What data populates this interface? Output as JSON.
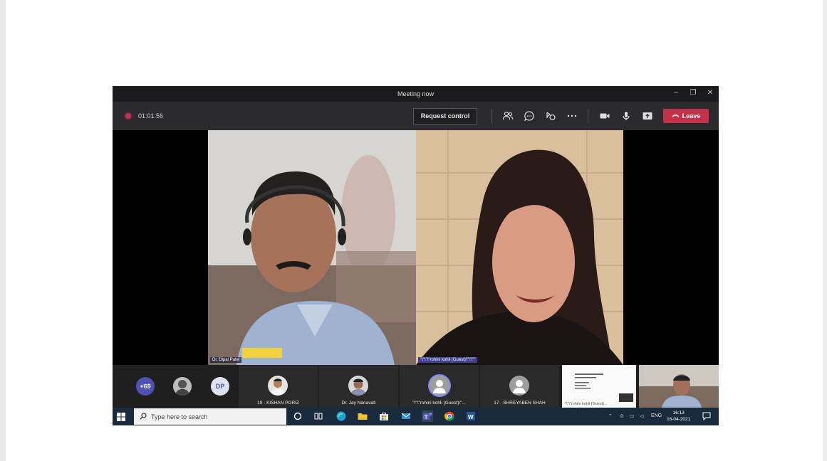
{
  "window": {
    "title": "Meeting now",
    "minimize_glyph": "–",
    "restore_glyph": "❐",
    "close_glyph": "✕"
  },
  "toolbar": {
    "timer": "01:01:56",
    "request_control_label": "Request control",
    "leave_label": "Leave",
    "icons": [
      "participants-icon",
      "chat-icon",
      "reactions-icon",
      "more-options-icon",
      "camera-icon",
      "microphone-icon",
      "share-screen-icon"
    ],
    "leave_color": "#c4314b"
  },
  "videos": [
    {
      "name": "Dr. Dipal Patel"
    },
    {
      "name": "\"\\\"\\\"\\\"rohini kohli (Guest)\\\"\\\"\\\"\""
    }
  ],
  "participant_strip": {
    "overflow_count": "+69",
    "initials_bubble": "DP",
    "tiles": [
      {
        "name": "19 - KISHAN PORIZ"
      },
      {
        "name": "Dr. Jay Nanavati"
      },
      {
        "name": "\"\\\"\\\"rohini kohli (Guest)\\\"...",
        "speaking": true
      },
      {
        "name": "17 - SHREYABEN SHAH"
      }
    ],
    "thumb_label": "\"\\\"\\\"rohini kohli (Guest)..."
  },
  "taskbar": {
    "search_placeholder": "Type here to search",
    "language": "ENG",
    "time": "16:13",
    "date": "16-04-2021"
  }
}
